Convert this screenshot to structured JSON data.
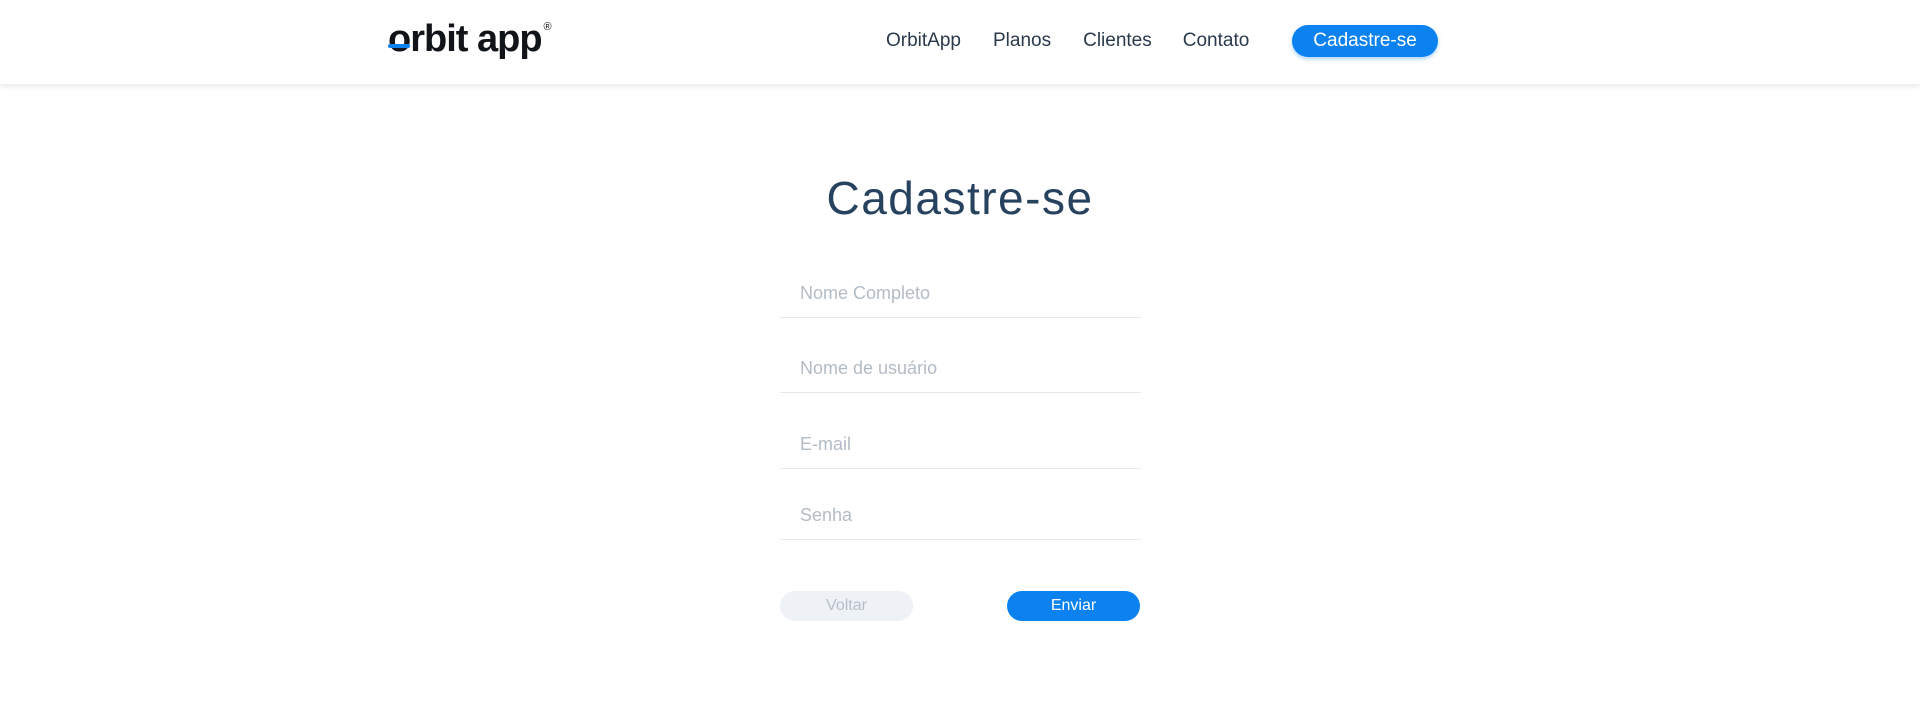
{
  "colors": {
    "accent": "#0b82f0",
    "title": "#27425e",
    "nav_text": "#2a3a4c",
    "placeholder": "#b3bcc6",
    "back_button_bg": "#eef2f6"
  },
  "header": {
    "logo": {
      "text": "orbit app",
      "mark": "®"
    },
    "nav": {
      "items": [
        {
          "label": "OrbitApp"
        },
        {
          "label": "Planos"
        },
        {
          "label": "Clientes"
        },
        {
          "label": "Contato"
        }
      ],
      "cta_label": "Cadastre-se"
    }
  },
  "main": {
    "title": "Cadastre-se",
    "form": {
      "fields": [
        {
          "placeholder": "Nome Completo",
          "value": ""
        },
        {
          "placeholder": "Nome de usuário",
          "value": ""
        },
        {
          "placeholder": "E-mail",
          "value": ""
        },
        {
          "placeholder": "Senha",
          "value": ""
        }
      ],
      "back_label": "Voltar",
      "submit_label": "Enviar"
    }
  }
}
